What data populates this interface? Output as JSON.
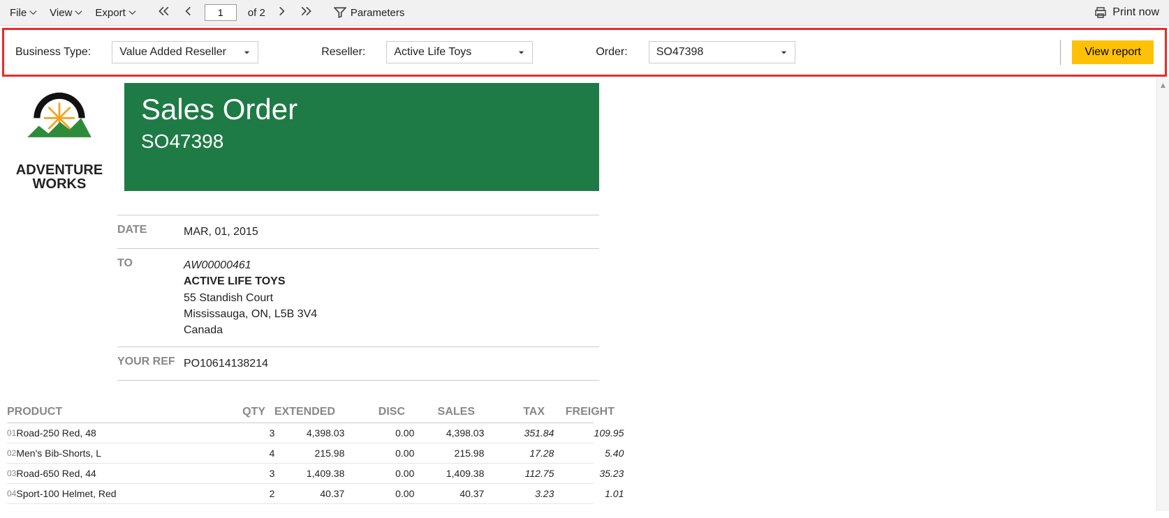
{
  "toolbar": {
    "file": "File",
    "view": "View",
    "export": "Export",
    "page_current": "1",
    "page_of": "of 2",
    "parameters": "Parameters",
    "print": "Print now"
  },
  "params": {
    "businessType": {
      "label": "Business Type:",
      "value": "Value Added Reseller"
    },
    "reseller": {
      "label": "Reseller:",
      "value": "Active Life Toys"
    },
    "order": {
      "label": "Order:",
      "value": "SO47398"
    },
    "viewBtn": "View report"
  },
  "logo": {
    "line1": "ADVENTURE",
    "line2": "WORKS"
  },
  "report": {
    "title": "Sales Order",
    "orderNumber": "SO47398",
    "info": {
      "dateLabel": "DATE",
      "date": "MAR, 01, 2015",
      "toLabel": "TO",
      "toCode": "AW00000461",
      "toName": "ACTIVE LIFE TOYS",
      "toAddr1": "55 Standish Court",
      "toAddr2": "Mississauga, ON, L5B 3V4",
      "toCountry": "Canada",
      "refLabel": "YOUR REF",
      "ref": "PO10614138214"
    },
    "columns": {
      "product": "PRODUCT",
      "qty": "QTY",
      "extended": "EXTENDED",
      "disc": "DISC",
      "sales": "SALES",
      "tax": "TAX",
      "freight": "FREIGHT"
    },
    "lines": [
      {
        "idx": "01",
        "product": "Road-250 Red, 48",
        "qty": "3",
        "extended": "4,398.03",
        "disc": "0.00",
        "sales": "4,398.03",
        "tax": "351.84",
        "freight": "109.95"
      },
      {
        "idx": "02",
        "product": "Men's Bib-Shorts, L",
        "qty": "4",
        "extended": "215.98",
        "disc": "0.00",
        "sales": "215.98",
        "tax": "17.28",
        "freight": "5.40"
      },
      {
        "idx": "03",
        "product": "Road-650 Red, 44",
        "qty": "3",
        "extended": "1,409.38",
        "disc": "0.00",
        "sales": "1,409.38",
        "tax": "112.75",
        "freight": "35.23"
      },
      {
        "idx": "04",
        "product": "Sport-100 Helmet, Red",
        "qty": "2",
        "extended": "40.37",
        "disc": "0.00",
        "sales": "40.37",
        "tax": "3.23",
        "freight": "1.01"
      }
    ]
  }
}
